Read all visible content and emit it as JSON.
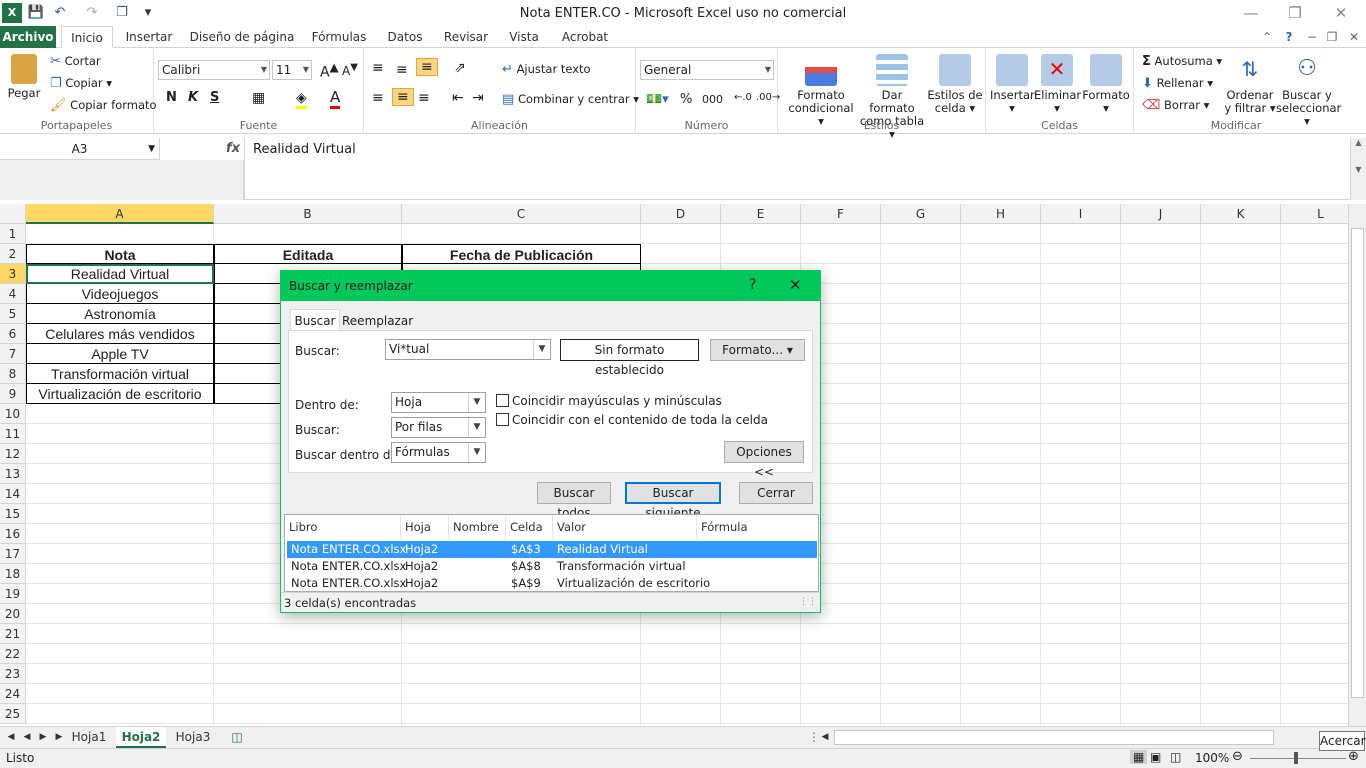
{
  "window": {
    "title": "Nota ENTER.CO  -  Microsoft Excel uso no comercial"
  },
  "tabs": [
    "Archivo",
    "Inicio",
    "Insertar",
    "Diseño de página",
    "Fórmulas",
    "Datos",
    "Revisar",
    "Vista",
    "Acrobat"
  ],
  "ribbon": {
    "portapapeles": {
      "paste": "Pegar",
      "cut": "Cortar",
      "copy": "Copiar",
      "format_painter": "Copiar formato",
      "label": "Portapapeles"
    },
    "fuente": {
      "font": "Calibri",
      "size": "11",
      "bold": "N",
      "italic": "K",
      "underline": "S",
      "label": "Fuente"
    },
    "alineacion": {
      "wrap": "Ajustar texto",
      "merge": "Combinar y centrar",
      "label": "Alineación"
    },
    "numero": {
      "format": "General",
      "percent": "%",
      "thousands": "000",
      "label": "Número"
    },
    "estilos": {
      "cond1": "Formato",
      "cond2": "condicional",
      "table1": "Dar formato",
      "table2": "como tabla",
      "cell1": "Estilos de",
      "cell2": "celda",
      "label": "Estilos"
    },
    "celdas": {
      "insert": "Insertar",
      "delete": "Eliminar",
      "format": "Formato",
      "label": "Celdas"
    },
    "modificar": {
      "autosum": "Autosuma",
      "fill": "Rellenar",
      "clear": "Borrar",
      "sort1": "Ordenar",
      "sort2": "y filtrar",
      "find1": "Buscar y",
      "find2": "seleccionar",
      "label": "Modificar"
    }
  },
  "formula_bar": {
    "name_box": "A3",
    "fx": "fx",
    "value": "Realidad Virtual"
  },
  "columns": [
    "A",
    "B",
    "C",
    "D",
    "E",
    "F",
    "G",
    "H",
    "I",
    "J",
    "K",
    "L"
  ],
  "rows": [
    "1",
    "2",
    "3",
    "4",
    "5",
    "6",
    "7",
    "8",
    "9",
    "10",
    "11",
    "12",
    "13",
    "14",
    "15",
    "16",
    "17",
    "18",
    "19",
    "20",
    "21",
    "22",
    "23",
    "24",
    "25"
  ],
  "table": {
    "headers": [
      "Nota",
      "Editada",
      "Fecha de Publicación"
    ],
    "notes": [
      "Realidad Virtual",
      "Videojuegos",
      "Astronomía",
      "Celulares más vendidos",
      "Apple TV",
      "Transformación virtual",
      "Virtualización de escritorio"
    ]
  },
  "dialog": {
    "title": "Buscar y reemplazar",
    "help": "?",
    "close": "✕",
    "tab_find": "Buscar",
    "tab_replace": "Reemplazar",
    "find_label": "Buscar:",
    "find_value": "Vi*tual",
    "no_format": "Sin formato establecido",
    "format_btn": "Formato...",
    "within_label": "Dentro de:",
    "within_value": "Hoja",
    "search_label": "Buscar:",
    "search_value": "Por filas",
    "lookin_label": "Buscar dentro de:",
    "lookin_value": "Fórmulas",
    "match_case": "Coincidir mayúsculas y minúsculas",
    "match_entire": "Coincidir con el contenido de toda la celda",
    "options_btn": "Opciones <<",
    "find_all": "Buscar todos",
    "find_next": "Buscar siguiente",
    "close_btn": "Cerrar",
    "result_headers": [
      "Libro",
      "Hoja",
      "Nombre",
      "Celda",
      "Valor",
      "Fórmula"
    ],
    "results": [
      {
        "libro": "Nota ENTER.CO.xlsx",
        "hoja": "Hoja2",
        "nombre": "",
        "celda": "$A$3",
        "valor": "Realidad Virtual",
        "formula": ""
      },
      {
        "libro": "Nota ENTER.CO.xlsx",
        "hoja": "Hoja2",
        "nombre": "",
        "celda": "$A$8",
        "valor": "Transformación virtual",
        "formula": ""
      },
      {
        "libro": "Nota ENTER.CO.xlsx",
        "hoja": "Hoja2",
        "nombre": "",
        "celda": "$A$9",
        "valor": "Virtualización de escritorio",
        "formula": ""
      }
    ],
    "status": "3 celda(s) encontradas"
  },
  "sheets": [
    "Hoja1",
    "Hoja2",
    "Hoja3"
  ],
  "status": {
    "ready": "Listo",
    "zoom": "100%",
    "tooltip": "Acercar"
  },
  "colors": {
    "excel_green": "#217346",
    "dialog_accent": "#00c85a",
    "selection": "#3399ff"
  }
}
